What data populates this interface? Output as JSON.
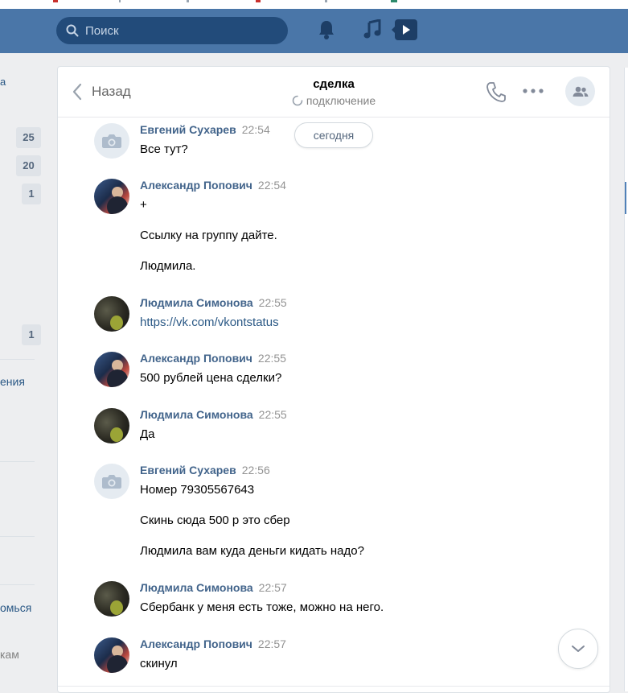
{
  "search": {
    "placeholder": "Поиск"
  },
  "left": {
    "badges": [
      "25",
      "20",
      "1",
      "1"
    ],
    "labels": [
      "ения",
      "омься",
      "кам"
    ]
  },
  "chat": {
    "back_label": "Назад",
    "title": "сделка",
    "status": "подключение",
    "date_chip": "сегодня"
  },
  "messages": [
    {
      "author": "Евгений Сухарев",
      "time": "22:54",
      "lines": [
        "Все тут?"
      ]
    },
    {
      "author": "Александр Попович",
      "time": "22:54",
      "lines": [
        "+",
        "Ссылку на группу дайте.",
        "Людмила."
      ]
    },
    {
      "author": "Людмила Симонова",
      "time": "22:55",
      "lines": [
        "https://vk.com/vkontstatus"
      ]
    },
    {
      "author": "Александр Попович",
      "time": "22:55",
      "lines": [
        "500 рублей цена сделки?"
      ]
    },
    {
      "author": "Людмила Симонова",
      "time": "22:55",
      "lines": [
        "Да"
      ]
    },
    {
      "author": "Евгений Сухарев",
      "time": "22:56",
      "lines": [
        "Номер 79305567643",
        "Скинь сюда 500 р это сбер",
        "Людмила вам куда деньги кидать надо?"
      ]
    },
    {
      "author": "Людмила Симонова",
      "time": "22:57",
      "lines": [
        "Сбербанк у меня есть тоже, можно на него."
      ]
    },
    {
      "author": "Александр Попович",
      "time": "22:57",
      "lines": [
        "скинул"
      ]
    }
  ],
  "colors": {
    "header": "#4a76a8",
    "author": "#42648b",
    "link": "#2a5885",
    "background": "#edeef0"
  },
  "icons": [
    "search-icon",
    "bell-icon",
    "music-icon",
    "video-icon",
    "back-arrow-icon",
    "spinner-icon",
    "phone-icon",
    "more-icon",
    "members-icon",
    "camera-icon",
    "chevron-down-icon"
  ]
}
